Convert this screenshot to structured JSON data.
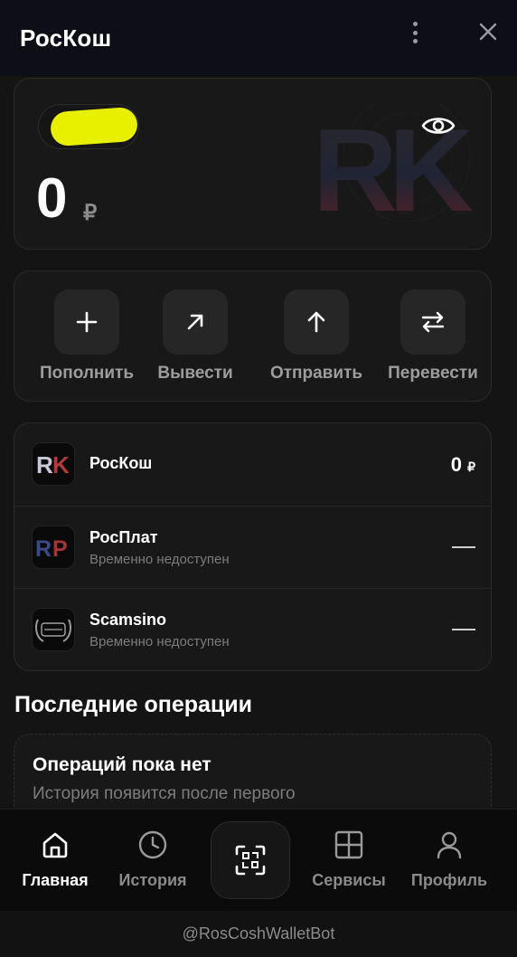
{
  "header": {
    "title": "РосКош",
    "icons": {
      "menu": "vertical-dots-icon",
      "close": "close-icon"
    }
  },
  "balance": {
    "amount": "0",
    "currency": "₽",
    "visibility_icon": "eye-icon",
    "name_redacted": true,
    "watermark_text": "RK"
  },
  "actions": [
    {
      "label": "Пополнить",
      "icon": "plus-icon"
    },
    {
      "label": "Вывести",
      "icon": "arrow-up-right-icon"
    },
    {
      "label": "Отправить",
      "icon": "arrow-up-icon"
    },
    {
      "label": "Перевести",
      "icon": "swap-arrows-icon"
    }
  ],
  "wallets": [
    {
      "name": "РосКош",
      "value": "0",
      "currency": "₽",
      "logo_text": "RK"
    },
    {
      "name": "РосПлат",
      "status": "Временно недоступен",
      "logo_text": "RP"
    },
    {
      "name": "Scamsino",
      "status": "Временно недоступен",
      "logo_text": "SCAM SINO"
    }
  ],
  "operations": {
    "title": "Последние операции",
    "empty_title": "Операций пока нет",
    "empty_text": "История появится после первого"
  },
  "nav": [
    {
      "label": "Главная",
      "icon": "home-icon",
      "active": true
    },
    {
      "label": "История",
      "icon": "clock-icon",
      "active": false
    },
    {
      "label": "",
      "icon": "scan-qr-icon",
      "active": false
    },
    {
      "label": "Сервисы",
      "icon": "grid-icon",
      "active": false
    },
    {
      "label": "Профиль",
      "icon": "user-icon",
      "active": false
    }
  ],
  "footer": {
    "bot_handle": "@RosCoshWalletBot"
  },
  "colors": {
    "background": "#121212",
    "card": "#181818",
    "highlight": "#e8f000",
    "muted_text": "#8b8b8b"
  }
}
